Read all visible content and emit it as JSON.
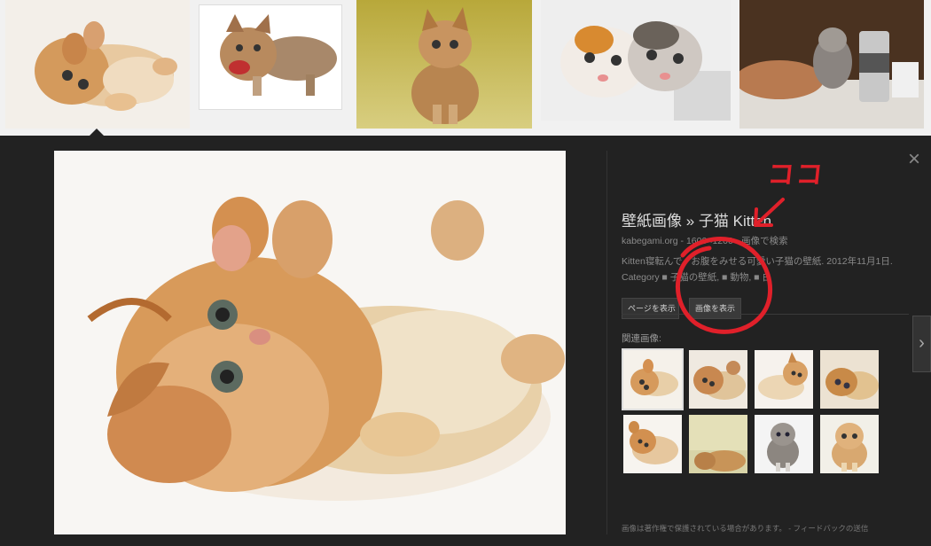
{
  "results_strip": {
    "thumbs": [
      "kitten-lying-on-back",
      "kitten-hissing",
      "kitten-sitting-yellow-bg",
      "two-kittens-faces",
      "kitten-held-by-hand-beer-can"
    ]
  },
  "details": {
    "title": "壁紙画像 » 子猫 Kitten",
    "source": "kabegami.org",
    "dimensions": "1600×1200",
    "separator": "-",
    "search_by_image": "画像で検索",
    "description": "Kitten寝転んで、お腹をみせる可愛い子猫の壁紙. 2012年11月1日.",
    "category_prefix": "Category",
    "category_1": "子猫の壁紙",
    "category_2": "動物",
    "category_3": "白",
    "category_bullet": "■",
    "visit_page_button": "ページを表示",
    "view_image_button": "画像を表示",
    "related_label": "関連画像:",
    "footer_text": "画像は著作権で保護されている場合があります。",
    "footer_sep": "-",
    "feedback_link": "フィードバックの送信"
  },
  "annotation": {
    "text": "ココ",
    "color": "#e0202a"
  },
  "icons": {
    "close": "×",
    "next": "›"
  },
  "colors": {
    "viewer_bg": "#222222",
    "strip_bg": "#f1f1f1",
    "annotation_red": "#e0202a"
  }
}
